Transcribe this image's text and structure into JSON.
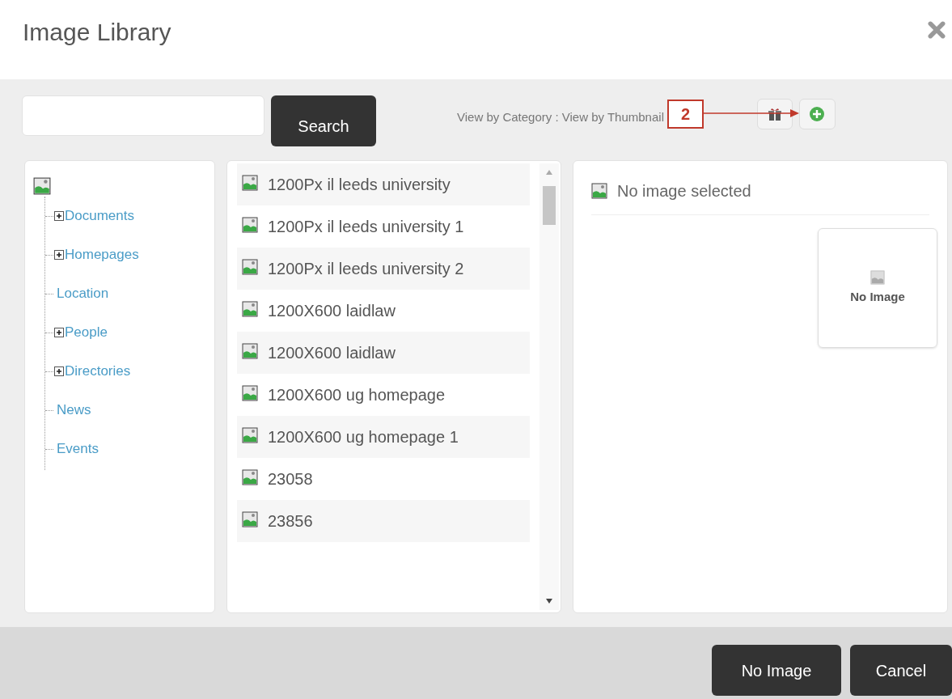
{
  "dialog": {
    "title": "Image Library"
  },
  "search": {
    "button": "Search"
  },
  "view_links": "View by Category : View by Thumbnail",
  "annotation": {
    "label": "2"
  },
  "tree": {
    "items": [
      {
        "label": "Documents",
        "kind": "folder"
      },
      {
        "label": "Homepages",
        "kind": "folder"
      },
      {
        "label": "Location",
        "kind": "leaf"
      },
      {
        "label": "People",
        "kind": "folder"
      },
      {
        "label": "Directories",
        "kind": "folder"
      },
      {
        "label": "News",
        "kind": "leaf"
      },
      {
        "label": "Events",
        "kind": "leaf"
      }
    ]
  },
  "images": [
    {
      "name": "1200Px il leeds university"
    },
    {
      "name": "1200Px il leeds university 1"
    },
    {
      "name": "1200Px il leeds university 2"
    },
    {
      "name": "1200X600 laidlaw"
    },
    {
      "name": "1200X600 laidlaw"
    },
    {
      "name": "1200X600 ug homepage"
    },
    {
      "name": "1200X600 ug homepage 1"
    },
    {
      "name": "23058"
    },
    {
      "name": "23856"
    }
  ],
  "detail": {
    "heading": "No image selected",
    "thumbnail_label": "No Image"
  },
  "footer_buttons": [
    "No Image",
    "Cancel"
  ]
}
